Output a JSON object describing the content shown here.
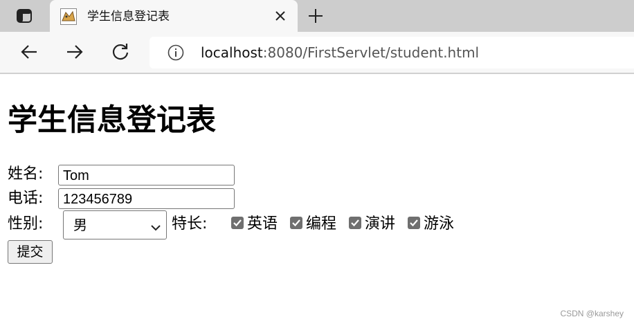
{
  "browser": {
    "tab_title": "学生信息登记表",
    "url_host": "localhost",
    "url_rest": ":8080/FirstServlet/student.html"
  },
  "page": {
    "heading": "学生信息登记表",
    "name_label": "姓名:",
    "name_value": "Tom",
    "phone_label": "电话:",
    "phone_value": "123456789",
    "gender_label": "性别:",
    "gender_selected": "男",
    "skills_label": "特长:",
    "skills": [
      {
        "label": "英语",
        "checked": true
      },
      {
        "label": "编程",
        "checked": true
      },
      {
        "label": "演讲",
        "checked": true
      },
      {
        "label": "游泳",
        "checked": true
      }
    ],
    "submit_label": "提交"
  },
  "watermark": "CSDN @karshey",
  "icons": [
    "sidebar-icon",
    "favicon",
    "close-icon",
    "plus-icon",
    "back-arrow-icon",
    "forward-arrow-icon",
    "reload-icon",
    "info-icon",
    "chevron-down-icon",
    "checkmark-icon"
  ]
}
